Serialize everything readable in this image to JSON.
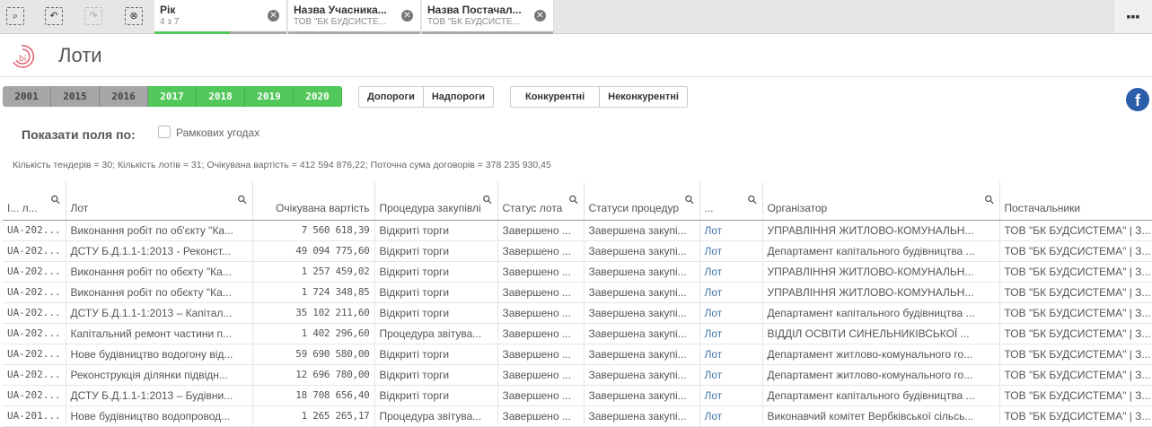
{
  "toolbar": {
    "icons": [
      "smart-search-icon",
      "step-back-icon",
      "step-forward-icon",
      "clear-selections-icon"
    ]
  },
  "selections": [
    {
      "title": "Рік",
      "sub": "4 з 7",
      "fill": 0.57
    },
    {
      "title": "Назва Учасника...",
      "sub": "ТОВ \"БК БУДСИСТЕ...",
      "fill": 0
    },
    {
      "title": "Назва Постачал...",
      "sub": "ТОВ \"БК БУДСИСТЕ...",
      "fill": 0
    }
  ],
  "header": {
    "title": "Лоти",
    "logo_text": "bi"
  },
  "years": [
    {
      "label": "2001",
      "selected": false
    },
    {
      "label": "2015",
      "selected": false
    },
    {
      "label": "2016",
      "selected": false
    },
    {
      "label": "2017",
      "selected": true
    },
    {
      "label": "2018",
      "selected": true
    },
    {
      "label": "2019",
      "selected": true
    },
    {
      "label": "2020",
      "selected": true
    }
  ],
  "threshold": [
    "Допороги",
    "Надпороги"
  ],
  "competition": [
    "Конкурентні",
    "Неконкурентні"
  ],
  "show_fields": {
    "label": "Показати поля по:",
    "checkbox": "Рамкових угодах",
    "checked": false
  },
  "summary": "Кількість тендерів = 30; Кількість лотів = 31; Очікувана вартість = 412 594 876,22; Поточна сума договорів = 378 235 930,45",
  "colors": {
    "accent": "#52c75a",
    "link": "#4477aa",
    "facebook": "#2a5ea8"
  },
  "table": {
    "columns": [
      "І... л...",
      "Лот",
      "Очікувана вартість",
      "Процедура закупівлі",
      "Статус лота",
      "Статуси процедур",
      "...",
      "Організатор",
      "Постачальники"
    ],
    "rows": [
      [
        "UA-202...",
        "Виконання робіт по об'єкту \"Ка...",
        "7 560 618,39",
        "Відкриті торги",
        "Завершено ...",
        "Завершена закупі...",
        "Лот",
        "УПРАВЛІННЯ ЖИТЛОВО-КОМУНАЛЬН...",
        "ТОВ \"БК БУДСИСТЕМА\" | З..."
      ],
      [
        "UA-202...",
        "ДСТУ Б.Д.1.1-1:2013 - Реконст...",
        "49 094 775,60",
        "Відкриті торги",
        "Завершено ...",
        "Завершена закупі...",
        "Лот",
        "Департамент капітального будівництва ...",
        "ТОВ \"БК БУДСИСТЕМА\" | З..."
      ],
      [
        "UA-202...",
        "Виконання робіт по обєкту \"Ка...",
        "1 257 459,02",
        "Відкриті торги",
        "Завершено ...",
        "Завершена закупі...",
        "Лот",
        "УПРАВЛІННЯ ЖИТЛОВО-КОМУНАЛЬН...",
        "ТОВ \"БК БУДСИСТЕМА\" | З..."
      ],
      [
        "UA-202...",
        "Виконання робіт по обєкту \"Ка...",
        "1 724 348,85",
        "Відкриті торги",
        "Завершено ...",
        "Завершена закупі...",
        "Лот",
        "УПРАВЛІННЯ ЖИТЛОВО-КОМУНАЛЬН...",
        "ТОВ \"БК БУДСИСТЕМА\" | З..."
      ],
      [
        "UA-202...",
        "ДСТУ Б.Д.1.1-1:2013 – Капітал...",
        "35 102 211,60",
        "Відкриті торги",
        "Завершено ...",
        "Завершена закупі...",
        "Лот",
        "Департамент капітального будівництва ...",
        "ТОВ \"БК БУДСИСТЕМА\" | З..."
      ],
      [
        "UA-202...",
        "Капітальний ремонт частини п...",
        "1 402 296,60",
        "Процедура звітува...",
        "Завершено ...",
        "Завершена закупі...",
        "Лот",
        "ВІДДІЛ ОСВІТИ СИНЕЛЬНИКІВСЬКОЇ ...",
        "ТОВ \"БК БУДСИСТЕМА\" | З..."
      ],
      [
        "UA-202...",
        "Нове будівництво водогону від...",
        "59 690 580,00",
        "Відкриті торги",
        "Завершено ...",
        "Завершена закупі...",
        "Лот",
        "Департамент житлово-комунального го...",
        "ТОВ \"БК БУДСИСТЕМА\" | З..."
      ],
      [
        "UA-202...",
        "Реконструкція ділянки підвідн...",
        "12 696 780,00",
        "Відкриті торги",
        "Завершено ...",
        "Завершена закупі...",
        "Лот",
        "Департамент житлово-комунального го...",
        "ТОВ \"БК БУДСИСТЕМА\" | З..."
      ],
      [
        "UA-202...",
        "ДСТУ Б.Д.1.1-1:2013 – Будівни...",
        "18 708 656,40",
        "Відкриті торги",
        "Завершено ...",
        "Завершена закупі...",
        "Лот",
        "Департамент капітального будівництва ...",
        "ТОВ \"БК БУДСИСТЕМА\" | З..."
      ],
      [
        "UA-201...",
        "Нове будівництво водопровод...",
        "1 265 265,17",
        "Процедура звітува...",
        "Завершено ...",
        "Завершена закупі...",
        "Лот",
        "Виконавчий комітет Вербківської сільсь...",
        "ТОВ \"БК БУДСИСТЕМА\" | З..."
      ]
    ]
  }
}
